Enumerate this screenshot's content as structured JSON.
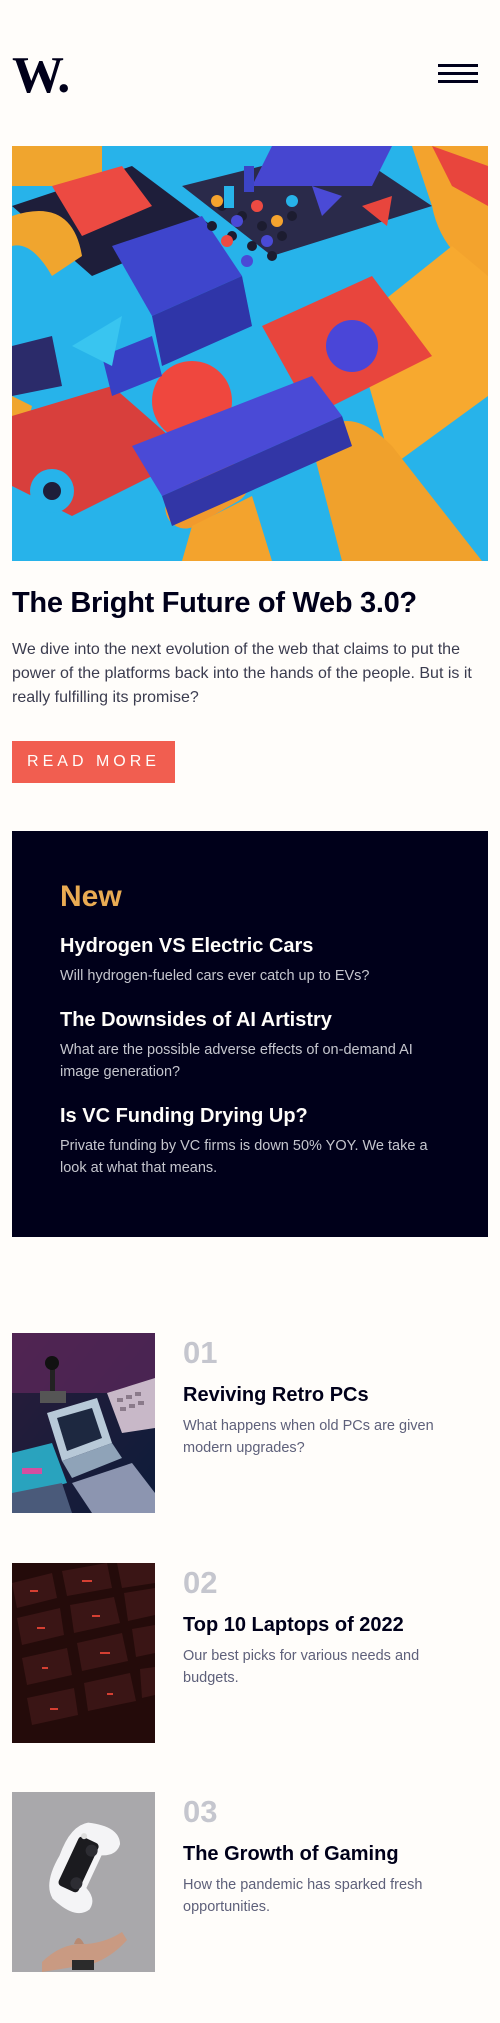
{
  "header": {
    "logo_text": "W.",
    "menu_icon": "hamburger-menu-icon"
  },
  "hero": {
    "image_alt": "colorful 3D shapes",
    "title": "The Bright Future of Web 3.0?",
    "description": "We dive into the next evolution of the web that claims to put the power of the platforms back into the hands of the people. But is it really fulfilling its promise?",
    "button_label": "READ MORE"
  },
  "new_section": {
    "heading": "New",
    "items": [
      {
        "title": "Hydrogen VS Electric Cars",
        "description": "Will hydrogen-fueled cars ever catch up to EVs?"
      },
      {
        "title": "The Downsides of AI Artistry",
        "description": "What are the possible adverse effects of on-demand AI image generation?"
      },
      {
        "title": "Is VC Funding Drying Up?",
        "description": "Private funding by VC firms is down 50% YOY. We take a look at what that means."
      }
    ]
  },
  "articles": [
    {
      "number": "01",
      "title": "Reviving Retro PCs",
      "description": "What happens when old PCs are given modern upgrades?"
    },
    {
      "number": "02",
      "title": "Top 10 Laptops of 2022",
      "description": "Our best picks for various needs and budgets."
    },
    {
      "number": "03",
      "title": "The Growth of Gaming",
      "description": "How the pandemic has sparked fresh opportunities."
    }
  ],
  "colors": {
    "background": "#fffdfa",
    "dark_navy": "#00001a",
    "soft_red": "#f15e50",
    "soft_orange": "#e9ab53",
    "grayish_blue": "#5e607a",
    "light_gray": "#c5c6ce"
  }
}
